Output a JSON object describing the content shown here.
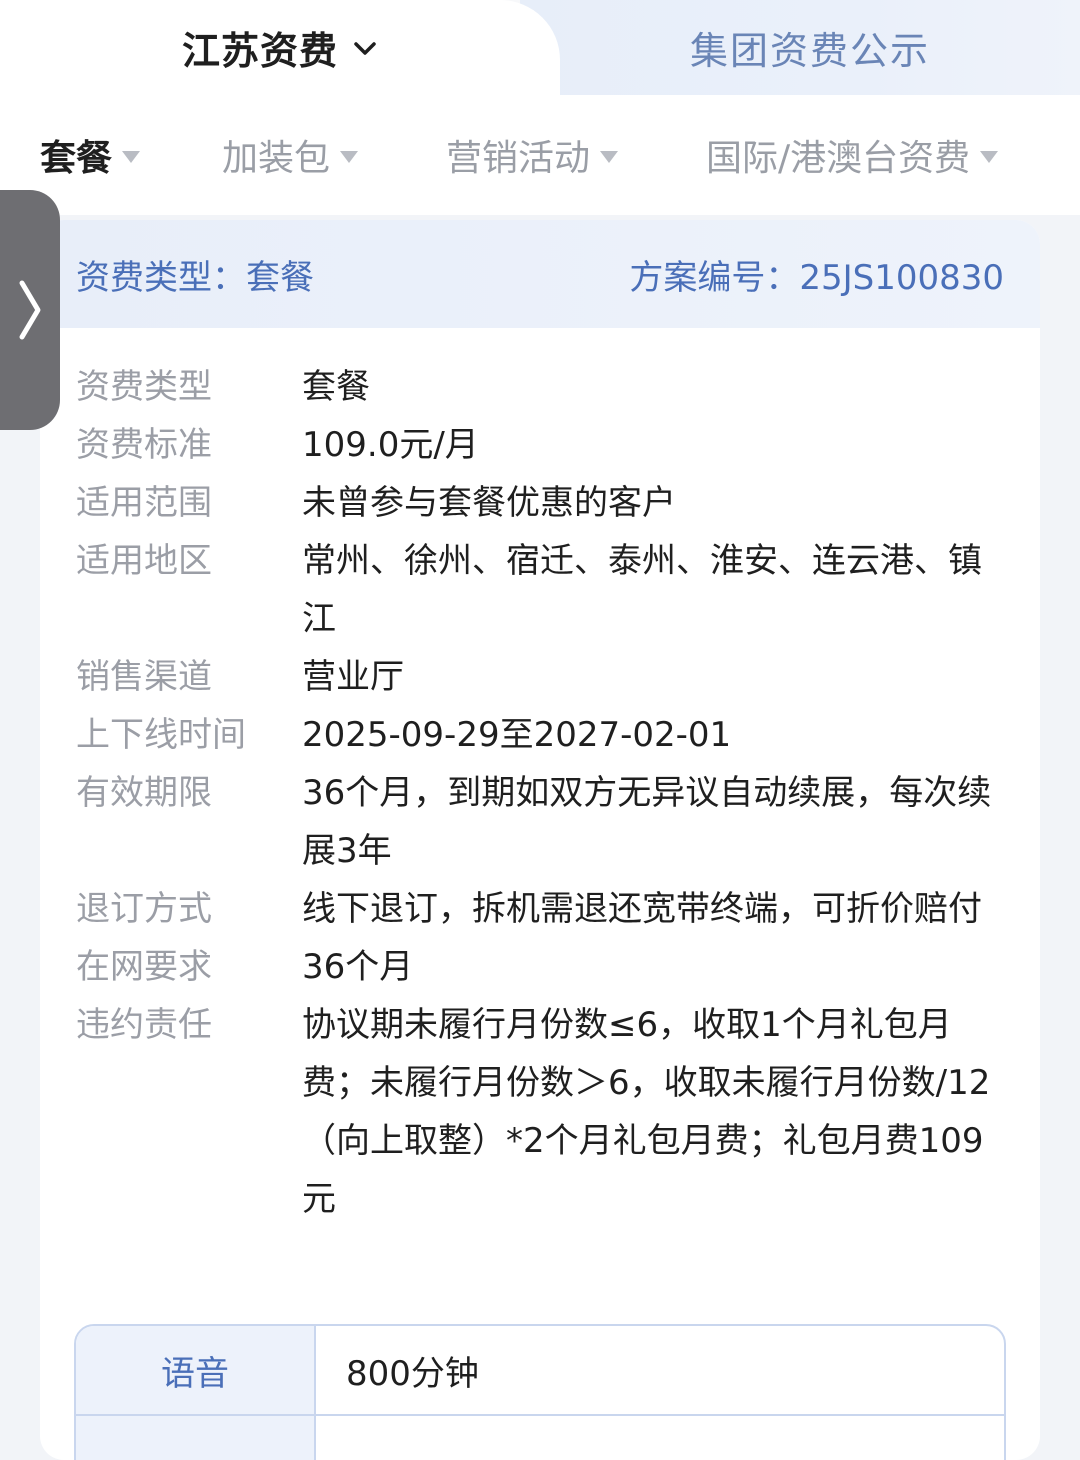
{
  "header": {
    "left_tab": "江苏资费",
    "right_tab": "集团资费公示"
  },
  "category_tabs": [
    {
      "label": "套餐",
      "active": true
    },
    {
      "label": "加装包",
      "active": false
    },
    {
      "label": "营销活动",
      "active": false
    },
    {
      "label": "国际/港澳台资费",
      "active": false
    }
  ],
  "card": {
    "type_label": "资费类型：套餐",
    "plan_no_label": "方案编号：25JS100830",
    "rows": [
      {
        "key": "资费类型",
        "value": "套餐"
      },
      {
        "key": "资费标准",
        "value": "109.0元/月"
      },
      {
        "key": "适用范围",
        "value": "未曾参与套餐优惠的客户"
      },
      {
        "key": "适用地区",
        "value": "常州、徐州、宿迁、泰州、淮安、连云港、镇江"
      },
      {
        "key": "销售渠道",
        "value": "营业厅"
      },
      {
        "key": "上下线时间",
        "value": "2025-09-29至2027-02-01"
      },
      {
        "key": "有效期限",
        "value": "36个月，到期如双方无异议自动续展，每次续展3年"
      },
      {
        "key": "退订方式",
        "value": "线下退订，拆机需退还宽带终端，可折价赔付"
      },
      {
        "key": "在网要求",
        "value": "36个月"
      },
      {
        "key": "违约责任",
        "value": "协议期未履行月份数≤6，收取1个月礼包月费；未履行月份数＞6，收取未履行月份数/12（向上取整）*2个月礼包月费；礼包月费109元"
      }
    ],
    "table": [
      {
        "key": "语音",
        "value": "800分钟"
      },
      {
        "key": "",
        "value": ""
      }
    ]
  },
  "icons": {
    "chevron": "chevron-down-icon",
    "drawer": "chevron-right-icon",
    "dropdown": "triangle-down-icon"
  }
}
